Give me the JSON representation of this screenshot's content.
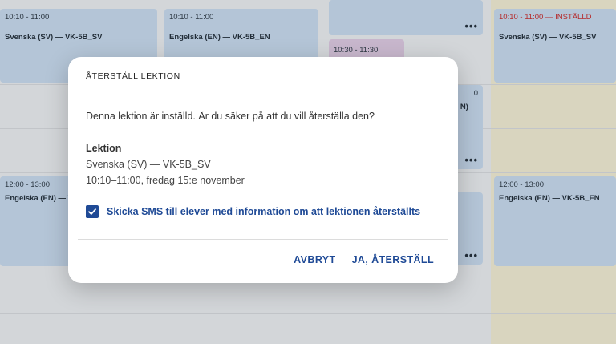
{
  "calendar": {
    "lessons": [
      {
        "time": "10:10 - 11:00",
        "title": "Svenska (SV) — VK-5B_SV"
      },
      {
        "time": "10:10 - 11:00",
        "title": "Engelska (EN) — VK-5B_EN"
      },
      {
        "time": "10:30 - 11:30",
        "title": ""
      },
      {
        "time": "10:10 - 11:00 — INSTÄLLD",
        "title": "Svenska (SV) — VK-5B_SV"
      },
      {
        "time": "12:00 - 13:00",
        "title": "Engelska (EN) — VK-5B_EN"
      },
      {
        "time": "12:00 - 13:00",
        "title": "Engelska (EN) — VK-5B_EN"
      },
      {
        "time": "0",
        "title": "N) —"
      }
    ],
    "more_glyph": "•••"
  },
  "dialog": {
    "title": "ÅTERSTÄLL LEKTION",
    "question": "Denna lektion är inställd. Är du säker på att du vill återställa den?",
    "lesson_label": "Lektion",
    "lesson_subject": "Svenska (SV) — VK-5B_SV",
    "lesson_when": "10:10–11:00, fredag 15:e november",
    "sms_checkbox_label": "Skicka SMS till elever med information om att lektionen återställts",
    "sms_checked": true,
    "cancel_label": "AVBRYT",
    "confirm_label": "JA, ÅTERSTÄLL"
  },
  "colors": {
    "accent": "#1f4a96",
    "cancelled": "#c62828",
    "lesson": "#c5d7ea",
    "lesson_alt": "#dcc6df",
    "today_column": "#efe9cf"
  }
}
